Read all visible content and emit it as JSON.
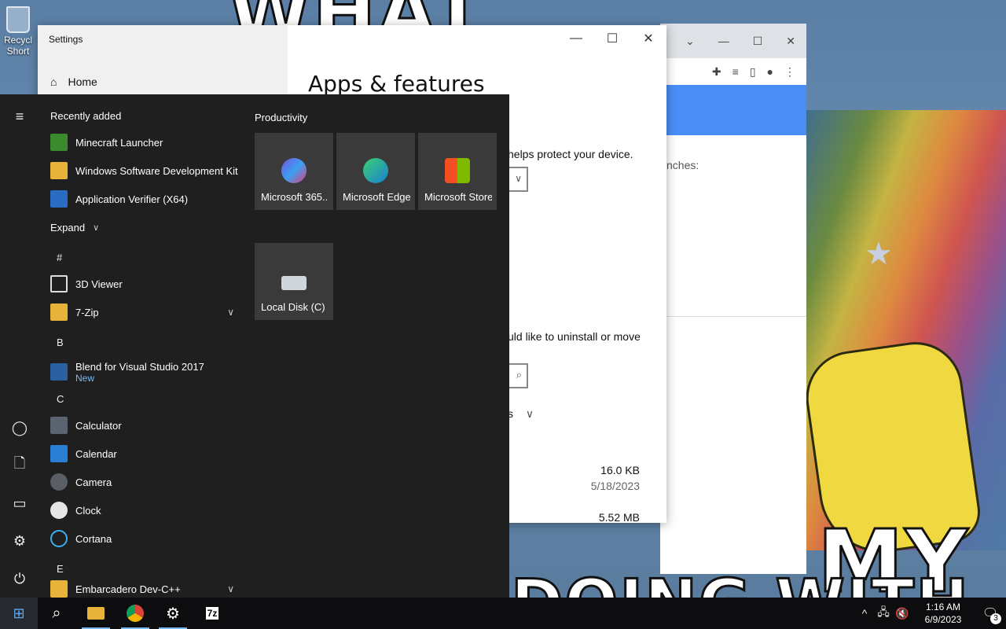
{
  "desktop": {
    "recycle_label": "Recycl",
    "recycle_sub": "Short",
    "wallpaper_top": "WHAT",
    "wallpaper_my": "MY",
    "wallpaper_bottom": "DOING WITH"
  },
  "browser": {
    "content_fragment": "nches:"
  },
  "settings": {
    "title": "Settings",
    "home_label": "Home",
    "page_title": "Apps & features",
    "fragment_protect": "helps protect your device.",
    "fragment_uninstall": "uld like to uninstall or move",
    "fragment_sort": "s",
    "rows": [
      {
        "size": "16.0 KB",
        "date": "5/18/2023"
      },
      {
        "size": "5.52 MB"
      }
    ]
  },
  "start_menu": {
    "recently_added_label": "Recently added",
    "recent": [
      {
        "name": "Minecraft Launcher"
      },
      {
        "name": "Windows Software Development Kit"
      },
      {
        "name": "Application Verifier (X64)"
      }
    ],
    "expand_label": "Expand",
    "letters": {
      "hash": "#",
      "b": "B",
      "c": "C",
      "e": "E"
    },
    "apps": {
      "viewer3d": "3D Viewer",
      "zip7": "7-Zip",
      "blend": "Blend for Visual Studio 2017",
      "blend_badge": "New",
      "calculator": "Calculator",
      "calendar": "Calendar",
      "camera": "Camera",
      "clock": "Clock",
      "cortana": "Cortana",
      "devcpp": "Embarcadero Dev-C++"
    },
    "tiles_group": "Productivity",
    "tiles": [
      {
        "label": "Microsoft 365..."
      },
      {
        "label": "Microsoft Edge"
      },
      {
        "label": "Microsoft Store"
      },
      {
        "label": "Local Disk (C)"
      }
    ]
  },
  "taskbar": {
    "time": "1:16 AM",
    "date": "6/9/2023",
    "notification_count": "3",
    "zip_label": "7z"
  },
  "colors": {
    "start_bg": "#1f1f1f",
    "tile_bg": "#3a3a3a",
    "accent": "#7ab8f0",
    "taskbar_bg": "#0d0d10"
  }
}
